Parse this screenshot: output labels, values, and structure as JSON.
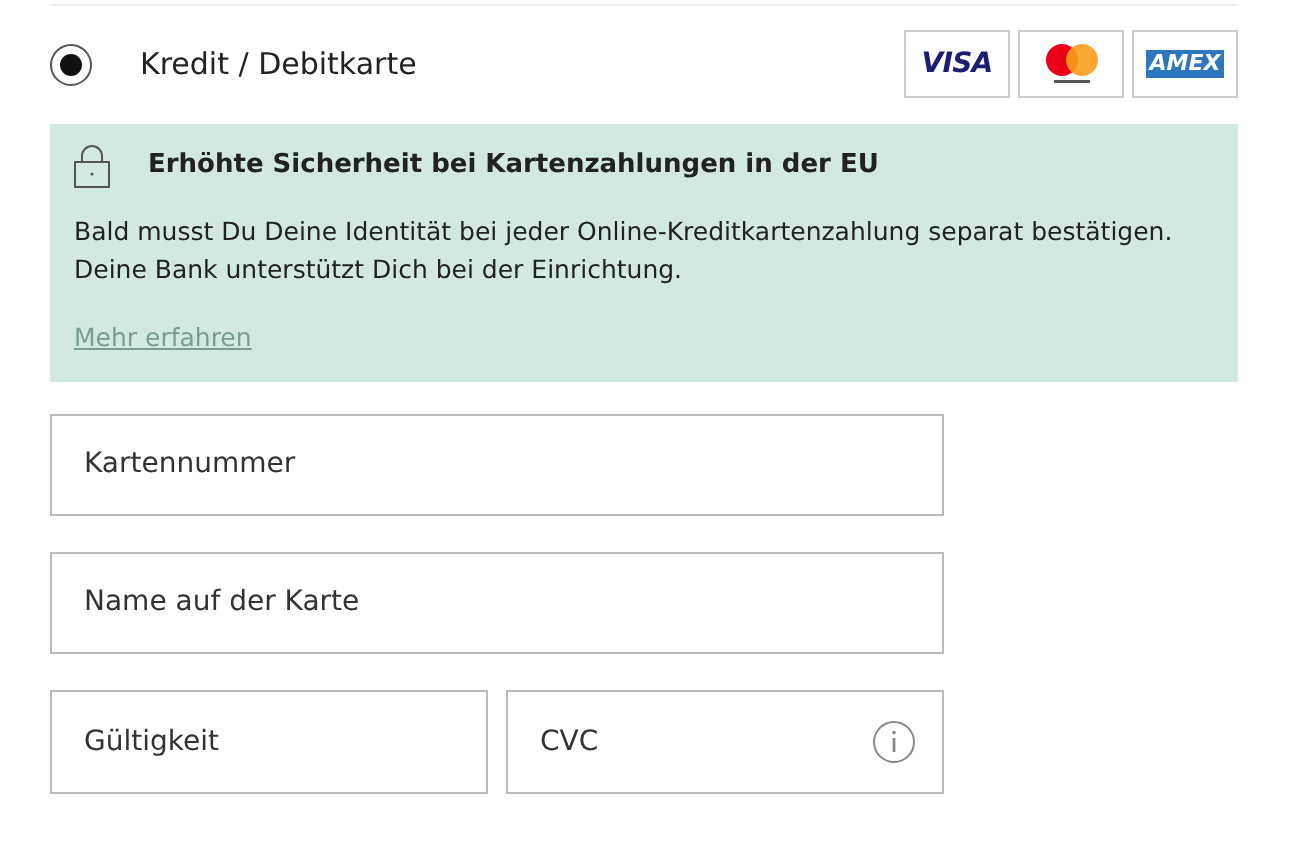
{
  "payment_option": {
    "label": "Kredit / Debitkarte",
    "selected": true,
    "card_logos": [
      {
        "kind": "visa",
        "text": "VISA"
      },
      {
        "kind": "mastercard"
      },
      {
        "kind": "amex",
        "text": "AMEX"
      }
    ]
  },
  "notice": {
    "title": "Erhöhte Sicherheit bei Kartenzahlungen in der EU",
    "body": "Bald musst Du Deine Identität bei jeder Online-Kreditkartenzahlung separat bestätigen. Deine Bank unterstützt Dich bei der Einrichtung.",
    "link": "Mehr erfahren"
  },
  "fields": [
    {
      "placeholder": "Kartennummer",
      "kind": "full"
    },
    {
      "placeholder": "Name auf der Karte",
      "kind": "full"
    },
    {
      "placeholder": "Gültigkeit",
      "kind": "half"
    },
    {
      "placeholder": "CVC",
      "kind": "half",
      "info": true
    }
  ]
}
